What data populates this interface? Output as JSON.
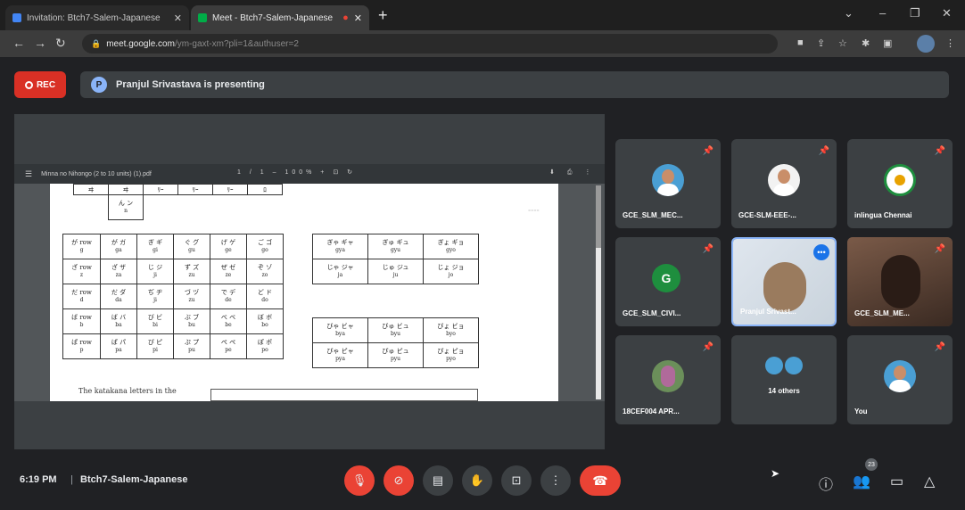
{
  "browser": {
    "tabs": [
      {
        "title": "Invitation: Btch7-Salem-Japanese",
        "close": "✕"
      },
      {
        "title": "Meet - Btch7-Salem-Japanese",
        "close": "✕"
      }
    ],
    "url_host": "meet.google.com",
    "url_path": "/ym-gaxt-xm?pli=1&authuser=2"
  },
  "meet": {
    "rec_label": "REC",
    "presenter_initial": "P",
    "presenting_text": "Pranjul Srivastava is presenting",
    "time": "6:19 PM",
    "separator": "|",
    "meeting_name": "Btch7-Salem-Japanese"
  },
  "pdf": {
    "filename": "Minna no Nihongo (2 to 10 units) (1).pdf",
    "page_counter": "1 / 1",
    "zoom": "100%",
    "caption": "The katakana letters in the"
  },
  "kana_top": {
    "row1": [
      "ヰ",
      "ヰ",
      "ﾘｰ",
      "ﾘｰ",
      "ﾘｰ",
      "ﾛ"
    ],
    "row2": [
      "ん ン",
      "n"
    ]
  },
  "kana_left": [
    {
      "label": "が row",
      "label_r": "g",
      "cells": [
        [
          "が ガ",
          "ga"
        ],
        [
          "ぎ ギ",
          "gi"
        ],
        [
          "ぐ グ",
          "gu"
        ],
        [
          "げ ゲ",
          "ge"
        ],
        [
          "ご ゴ",
          "go"
        ]
      ]
    },
    {
      "label": "ざ row",
      "label_r": "z",
      "cells": [
        [
          "ざ ザ",
          "za"
        ],
        [
          "じ ジ",
          "ji"
        ],
        [
          "ず ズ",
          "zu"
        ],
        [
          "ぜ ゼ",
          "ze"
        ],
        [
          "ぞ ゾ",
          "zo"
        ]
      ]
    },
    {
      "label": "だ row",
      "label_r": "d",
      "cells": [
        [
          "だ ダ",
          "da"
        ],
        [
          "ぢ ヂ",
          "ji"
        ],
        [
          "づ ヅ",
          "zu"
        ],
        [
          "で デ",
          "de"
        ],
        [
          "ど ド",
          "do"
        ]
      ]
    },
    {
      "label": "ば row",
      "label_r": "b",
      "cells": [
        [
          "ば バ",
          "ba"
        ],
        [
          "び ビ",
          "bi"
        ],
        [
          "ぶ ブ",
          "bu"
        ],
        [
          "べ ベ",
          "be"
        ],
        [
          "ぼ ボ",
          "bo"
        ]
      ]
    },
    {
      "label": "ぱ row",
      "label_r": "p",
      "cells": [
        [
          "ぱ パ",
          "pa"
        ],
        [
          "ぴ ピ",
          "pi"
        ],
        [
          "ぷ プ",
          "pu"
        ],
        [
          "ぺ ペ",
          "pe"
        ],
        [
          "ぽ ポ",
          "po"
        ]
      ]
    }
  ],
  "kana_right1": [
    [
      [
        "ぎゃ ギャ",
        "gya"
      ],
      [
        "ぎゅ ギュ",
        "gyu"
      ],
      [
        "ぎょ ギョ",
        "gyo"
      ]
    ],
    [
      [
        "じゃ ジャ",
        "ja"
      ],
      [
        "じゅ ジュ",
        "ju"
      ],
      [
        "じょ ジョ",
        "jo"
      ]
    ]
  ],
  "kana_right2": [
    [
      [
        "びゃ ビャ",
        "bya"
      ],
      [
        "びゅ ビュ",
        "byu"
      ],
      [
        "びょ ビョ",
        "byo"
      ]
    ],
    [
      [
        "ぴゃ ピャ",
        "pya"
      ],
      [
        "ぴゅ ピュ",
        "pyu"
      ],
      [
        "ぴょ ピョ",
        "pyo"
      ]
    ]
  ],
  "participants": [
    {
      "name": "GCE_SLM_MEC...",
      "kind": "avatar",
      "shirt": "#ffffff",
      "bg": "#4a9fd4"
    },
    {
      "name": "GCE-SLM-EEE-...",
      "kind": "avatar",
      "shirt": "#ffffff",
      "bg": "#f2f2f2"
    },
    {
      "name": "inlingua Chennai",
      "kind": "logo",
      "bg": "#1e8e3e"
    },
    {
      "name": "GCE_SLM_CIVI...",
      "kind": "letter",
      "letter": "G"
    },
    {
      "name": "Pranjul Srivast...",
      "kind": "video-light"
    },
    {
      "name": "GCE_SLM_ME...",
      "kind": "video-dark"
    },
    {
      "name": "18CEF004 APR...",
      "kind": "avatar-plant"
    },
    {
      "name": "14 others",
      "kind": "others"
    },
    {
      "name": "You",
      "kind": "avatar",
      "shirt": "#ffffff",
      "bg": "#4a9fd4"
    }
  ],
  "controls": {
    "people_count": "23"
  }
}
